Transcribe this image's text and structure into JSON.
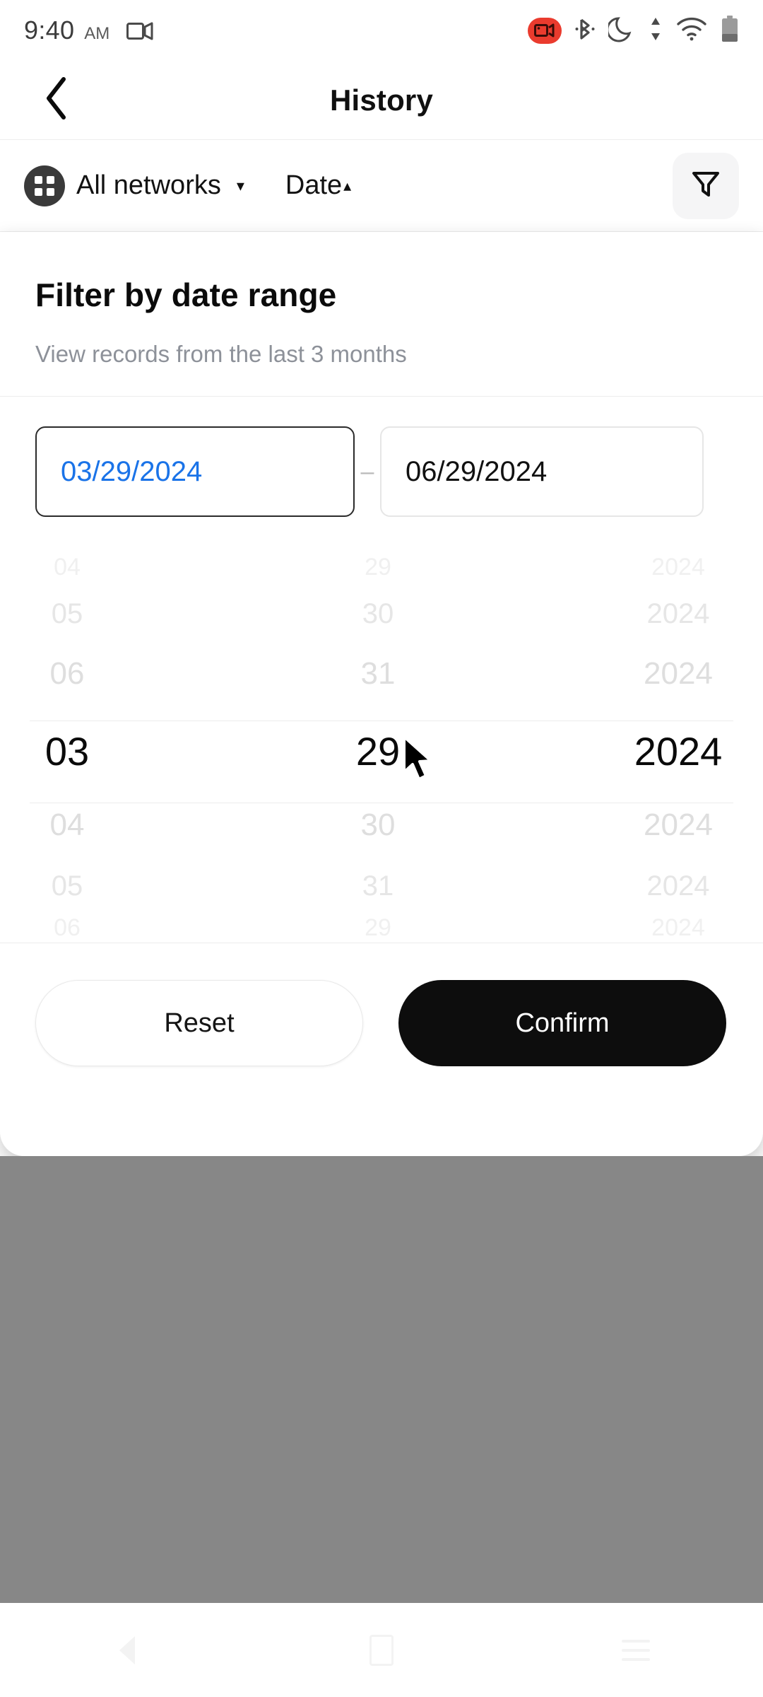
{
  "status_bar": {
    "time": "9:40",
    "ampm": "AM",
    "icons": [
      "screen-cast-icon",
      "screen-record-icon",
      "bluetooth-icon",
      "do-not-disturb-moon-icon",
      "data-transfer-icon",
      "wifi-icon",
      "battery-icon"
    ]
  },
  "app_bar": {
    "back_icon": "chevron-left-icon",
    "title": "History"
  },
  "filter_bar": {
    "network_icon": "grid-apps-icon",
    "network_label": "All networks",
    "network_caret": "▾",
    "sort_label": "Date",
    "sort_caret": "▴",
    "filter_icon": "funnel-filter-icon"
  },
  "sheet": {
    "title": "Filter by date range",
    "subtitle": "View records from the last 3 months",
    "start_date": "03/29/2024",
    "end_date": "06/29/2024",
    "range_separator": "–",
    "start_date_color": "#1a73e8",
    "end_date_color": "#111111",
    "reset_label": "Reset",
    "confirm_label": "Confirm",
    "confirm_bg": "#0d0d0d"
  },
  "picker": {
    "months": [
      "04",
      "05",
      "06",
      "03",
      "04",
      "05",
      "06"
    ],
    "days": [
      "29",
      "30",
      "31",
      "29",
      "30",
      "31",
      "29"
    ],
    "years": [
      "2024",
      "2024",
      "2024",
      "2024",
      "2024",
      "2024",
      "2024"
    ],
    "selected_index": 3,
    "selected_month": "03",
    "selected_day": "29",
    "selected_year": "2024"
  },
  "nav_bar": {
    "back_icon": "nav-back-icon",
    "home_icon": "nav-home-icon",
    "recents_icon": "nav-recents-icon"
  }
}
